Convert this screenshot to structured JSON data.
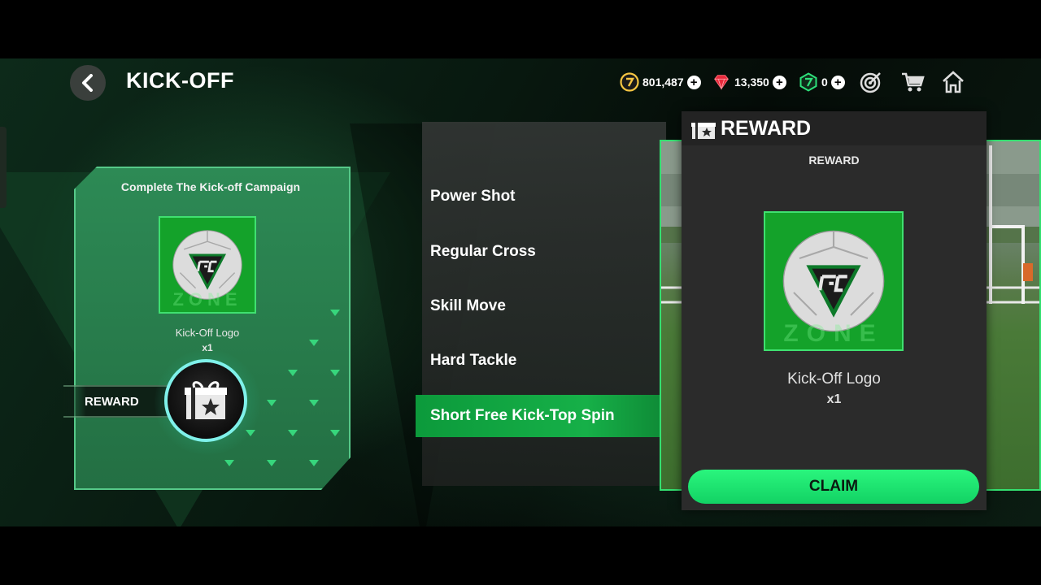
{
  "header": {
    "title": "KICK-OFF"
  },
  "currencies": [
    {
      "name": "coins",
      "value": "801,487",
      "color": "#f5c542"
    },
    {
      "name": "gems",
      "value": "13,350",
      "color": "#e8293b"
    },
    {
      "name": "tokens",
      "value": "0",
      "color": "#2ee07a"
    }
  ],
  "campaign": {
    "title": "Complete The Kick-off Campaign",
    "item_name": "Kick-Off Logo",
    "item_qty": "x1",
    "reward_label": "REWARD"
  },
  "skills": {
    "items": [
      "Power Shot",
      "Regular Cross",
      "Skill Move",
      "Hard Tackle",
      "Short Free Kick-Top Spin"
    ],
    "selected": "Short Free Kick-Top Spin"
  },
  "reward_popup": {
    "title": "REWARD",
    "subtitle": "REWARD",
    "item_name": "Kick-Off Logo",
    "item_qty": "x1",
    "claim_label": "CLAIM"
  },
  "colors": {
    "accent_green": "#16b048",
    "claim_green": "#1ee56f"
  }
}
